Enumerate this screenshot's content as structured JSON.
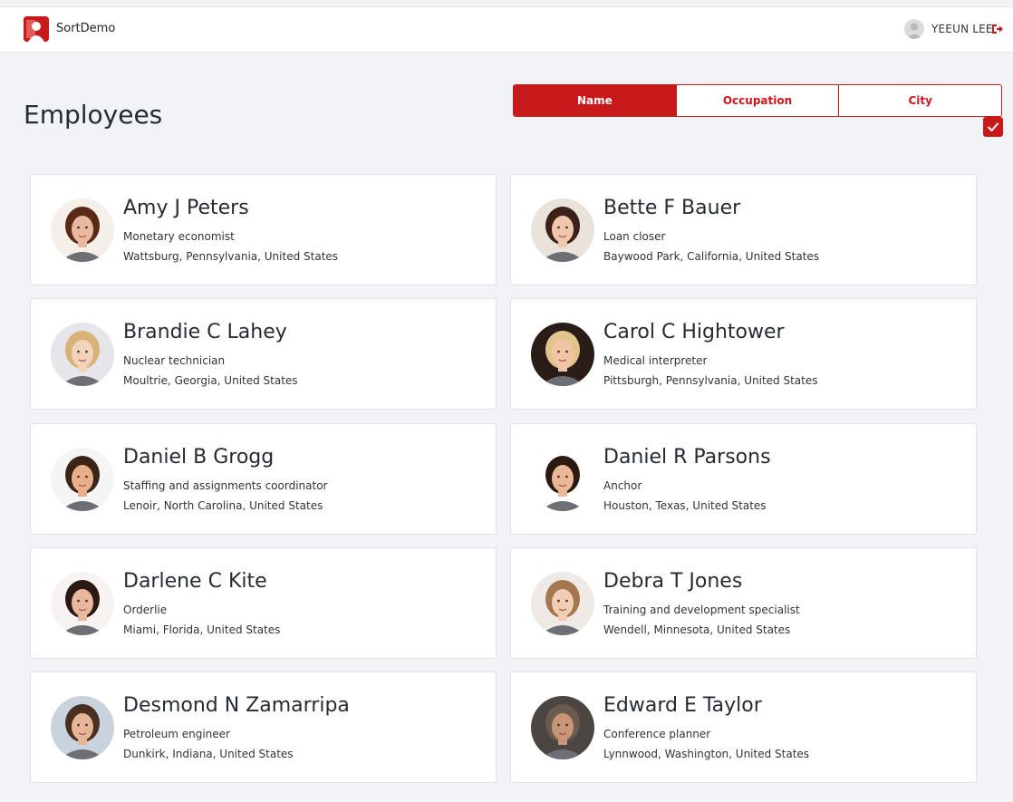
{
  "app": {
    "title": "SortDemo",
    "brand_color": "#c8191b",
    "user_name": "YEEUN LEE"
  },
  "page": {
    "title": "Employees"
  },
  "sort": {
    "options": [
      "Name",
      "Occupation",
      "City"
    ],
    "active": "Name",
    "ascending_checked": true
  },
  "employees": [
    {
      "name": "Amy J Peters",
      "occupation": "Monetary economist",
      "city": "Wattsburg, Pennsylvania, United States",
      "hair": "#5a2a16",
      "skin": "#e9b8a0",
      "bg": "#f4efe9"
    },
    {
      "name": "Bette F Bauer",
      "occupation": "Loan closer",
      "city": "Baywood Park, California, United States",
      "hair": "#3b2117",
      "skin": "#f0c7ad",
      "bg": "#eae3dc"
    },
    {
      "name": "Brandie C Lahey",
      "occupation": "Nuclear technician",
      "city": "Moultrie, Georgia, United States",
      "hair": "#d9b27a",
      "skin": "#f2d3bc",
      "bg": "#e6e6ea"
    },
    {
      "name": "Carol C Hightower",
      "occupation": "Medical interpreter",
      "city": "Pittsburgh, Pennsylvania, United States",
      "hair": "#e2c48e",
      "skin": "#f0c4a4",
      "bg": "#2a1d18"
    },
    {
      "name": "Daniel B Grogg",
      "occupation": "Staffing and assignments coordinator",
      "city": "Lenoir, North Carolina, United States",
      "hair": "#3a2418",
      "skin": "#e8b08a",
      "bg": "#f5f5f5"
    },
    {
      "name": "Daniel R Parsons",
      "occupation": "Anchor",
      "city": "Houston, Texas, United States",
      "hair": "#2a1a12",
      "skin": "#eab896",
      "bg": "#ffffff"
    },
    {
      "name": "Darlene C Kite",
      "occupation": "Orderlie",
      "city": "Miami, Florida, United States",
      "hair": "#2b1a14",
      "skin": "#e8b79c",
      "bg": "#f7f3f3"
    },
    {
      "name": "Debra T Jones",
      "occupation": "Training and development specialist",
      "city": "Wendell, Minnesota, United States",
      "hair": "#a6774f",
      "skin": "#f0cdb4",
      "bg": "#efeae5"
    },
    {
      "name": "Desmond N Zamarripa",
      "occupation": "Petroleum engineer",
      "city": "Dunkirk, Indiana, United States",
      "hair": "#4a3020",
      "skin": "#e6b596",
      "bg": "#c9d3de"
    },
    {
      "name": "Edward E Taylor",
      "occupation": "Conference planner",
      "city": "Lynnwood, Washington, United States",
      "hair": "#6b5b4e",
      "skin": "#c99578",
      "bg": "#4b4641"
    }
  ]
}
